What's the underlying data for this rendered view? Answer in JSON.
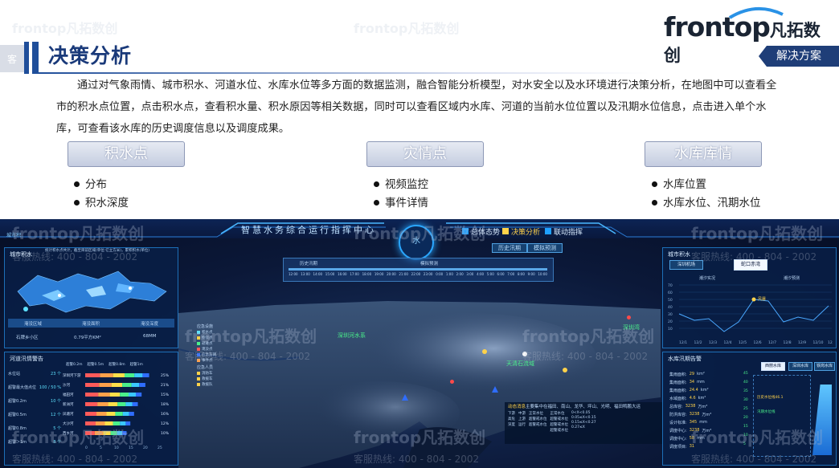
{
  "header": {
    "title": "决策分析",
    "logo_en": "frontop",
    "logo_cn": "凡拓数创",
    "badge": "解决方案",
    "side_tab": "客"
  },
  "description": "通过对气象雨情、城市积水、河道水位、水库水位等多方面的数据监测，融合智能分析模型，对水安全以及水环境进行决策分析，在地图中可以查看全市的积水点位置，点击积水点，查看积水量、积水原因等相关数据，同时可以查看区域内水库、河道的当前水位位置以及汛期水位信息，点击进入单个水库，可查看该水库的历史调度信息以及调度成果。",
  "categories": [
    {
      "label": "积水点",
      "items": [
        "分布",
        "积水深度"
      ]
    },
    {
      "label": "灾情点",
      "items": [
        "视频监控",
        "事件详情"
      ]
    },
    {
      "label": "水库库情",
      "items": [
        "水库位置",
        "水库水位、汛期水位"
      ]
    }
  ],
  "dashboard": {
    "title": "智慧水务综合运行指挥中心",
    "top_left": "城市积",
    "hex": "水",
    "nav": [
      "总体态势",
      "决策分析",
      "联动指挥"
    ],
    "sub_buttons": [
      "历史汛期",
      "模拟预测"
    ],
    "left_panel": {
      "title": "城市积水",
      "note": "统计积水点共计，截至目前区域(单位:亿立方米)，累积积水(单位)",
      "table_headers": [
        "淹没区域",
        "淹没面积",
        "淹没深度"
      ],
      "table_rows": [
        [
          "石牌乡小区",
          "0.79平方KM²",
          "68MM"
        ]
      ]
    },
    "left_bottom": {
      "title": "河道汛情警告",
      "legend": [
        "超警0.2m",
        "超警0.5m",
        "超警0.8m",
        "超警1m"
      ],
      "rows": [
        {
          "label": "水位站",
          "value": "23",
          "unit": "个"
        },
        {
          "label": "超警最大值点位",
          "value": "100 / 50",
          "unit": "%"
        },
        {
          "label": "超警0.2m",
          "value": "10",
          "unit": "个"
        },
        {
          "label": "超警0.5m",
          "value": "12",
          "unit": "个"
        },
        {
          "label": "超警0.8m",
          "value": "5",
          "unit": "个"
        },
        {
          "label": "超警＞1m",
          "value": "8",
          "unit": "个"
        }
      ],
      "bar_labels": [
        "深圳河下游",
        "沙河",
        "福田河",
        "新洲河",
        "凤塘河",
        "大沙河",
        "西乡河"
      ],
      "bar_pcts": [
        "25%",
        "21%",
        "15%",
        "18%",
        "16%",
        "12%",
        "10%"
      ],
      "x_ticks": [
        "0",
        "5",
        "10",
        "15",
        "20",
        "25"
      ]
    },
    "right_top": {
      "title": "城市积水",
      "tabs": [
        "深圳机场",
        "蛇口赤湾"
      ],
      "legend": [
        "潮汐实况",
        "潮汐预测"
      ],
      "highlight": "风暴",
      "x_ticks": [
        "12/1",
        "12/2",
        "12/3",
        "12/4",
        "12/5",
        "12/6",
        "12/7",
        "12/8",
        "12/9",
        "12/10",
        "12/11"
      ],
      "y_ticks": [
        "70",
        "60",
        "50",
        "40",
        "30",
        "20",
        "10"
      ]
    },
    "right_bottom": {
      "title": "水库汛期告警",
      "tabs": [
        "西丽水库",
        "深圳水库",
        "铁岗水库"
      ],
      "stats": [
        {
          "label": "集雨面积",
          "value": "29",
          "unit": "km²"
        },
        {
          "label": "集雨面积",
          "value": "34",
          "unit": "mm"
        },
        {
          "label": "集雨面积",
          "value": "24.4",
          "unit": "km²"
        },
        {
          "label": "水域面积",
          "value": "4.6",
          "unit": "km²"
        },
        {
          "label": "总库容",
          "value": "3238",
          "unit": "万m³"
        },
        {
          "label": "防洪库容",
          "value": "3238",
          "unit": "万m³"
        },
        {
          "label": "设计标准",
          "value": "345",
          "unit": "mm"
        },
        {
          "label": "调度中心",
          "value": "3238",
          "unit": "万m³"
        },
        {
          "label": "调度中心",
          "value": "58",
          "unit": "mm"
        },
        {
          "label": "调度项目",
          "value": "31",
          "unit": ""
        }
      ],
      "levels": [
        "45",
        "40",
        "35",
        "30",
        "25",
        "20",
        "15",
        "10",
        "5"
      ],
      "gauge_labels": [
        "历史水位线46.1",
        "汛期水位线"
      ]
    },
    "map_legend": {
      "title": "应急设施",
      "items": [
        "积水点",
        "物资点",
        "避难点",
        "淹没点",
        "应急车辆",
        "事件点"
      ],
      "sub": "应急人员",
      "sub_items": [
        "消防车",
        "救援车",
        "救援队"
      ]
    },
    "map_labels": [
      "深圳河水系",
      "天清石流域",
      "深圳湾"
    ],
    "bottom_legend": {
      "title_prefix": "动态消息",
      "title": "主要集中在福田、南山、龙华、坪山、光明、福田鸭鹏大运",
      "cols": [
        [
          "下游",
          "高危",
          "深度"
        ],
        [
          "中游",
          "上游",
          "运行"
        ],
        [
          "正常水位",
          "超警戒水位",
          "超警戒水位"
        ],
        [
          "正常水位",
          "超警戒水位",
          "超警戒水位",
          "超警戒水位"
        ],
        [
          "0<X<0.05",
          "0.05≤X<0.15",
          "0.15≤X<0.27",
          "0.27≤X"
        ]
      ]
    },
    "timeline": {
      "label": "历史汛期",
      "sub": "模拟预测",
      "ticks": [
        "12:00",
        "13:00",
        "14:00",
        "15:00",
        "16:00",
        "17:00",
        "18:00",
        "19:00",
        "20:00",
        "21:00",
        "22:00",
        "23:00",
        "0:00",
        "1:00",
        "2:00",
        "3:00",
        "4:00",
        "5:00",
        "6:00",
        "7:00",
        "8:00",
        "9:00",
        "10:00"
      ]
    },
    "watermarks": {
      "brand": "frontop凡拓数创",
      "hotline": "客服热线: 400 - 804 - 2002"
    }
  },
  "colors": {
    "title_blue": "#1a3a7a",
    "accent": "#1f4e9a",
    "dash_bg": "#0b1838",
    "dash_glow": "#2aa7ff",
    "highlight": "#ffd24a"
  }
}
